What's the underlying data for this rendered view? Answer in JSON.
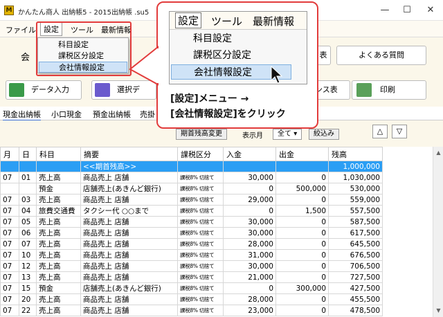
{
  "window": {
    "title": "かんたん商人 出納帳5 - 2015出納帳 .su5",
    "icon_letter": "M",
    "minimize": "—",
    "maximize": "☐",
    "close": "✕"
  },
  "menubar": {
    "file": "ファイル",
    "settings": "設定",
    "tools": "ツール",
    "latest_info": "最新情報"
  },
  "settings_menu": {
    "items": [
      "科目設定",
      "課税区分設定",
      "会社情報設定"
    ],
    "highlighted_index": 2
  },
  "callout": {
    "menu": {
      "settings": "設定",
      "tools": "ツール",
      "latest_info": "最新情報"
    },
    "items": [
      "科目設定",
      "課税区分設定",
      "会社情報設定"
    ],
    "instruction_line1": "[設定]メニュー →",
    "instruction_line2": "[会社情報設定]をクリック"
  },
  "toolbar": {
    "company_label": "会",
    "data_entry": "データ入力",
    "select_data": "選択デ",
    "balance_table": "ンス表",
    "print": "印刷",
    "faq": "よくある質問",
    "right_tab_partial": "表"
  },
  "tabs": [
    "現金出納帳",
    "小口現金",
    "預金出納帳",
    "売掛"
  ],
  "filter": {
    "opening_balance_change": "期首残高変更",
    "display_month": "表示月",
    "month_value": "全て",
    "narrow": "絞込み",
    "up": "△",
    "down": "▽"
  },
  "table": {
    "headers": [
      "月",
      "日",
      "科目",
      "摘要",
      "課税区分",
      "入金",
      "出金",
      "残高"
    ],
    "opening_row": {
      "label": "<<期首残高>>",
      "balance": "1,000,000"
    },
    "rows": [
      [
        "07",
        "01",
        "売上高",
        "商品売上 店舗",
        "課税8% 切捨て",
        "30,000",
        "0",
        "1,030,000"
      ],
      [
        "",
        "",
        "預金",
        "店舗売上(あきんど銀行)",
        "課税8% 切捨て",
        "0",
        "500,000",
        "530,000"
      ],
      [
        "07",
        "03",
        "売上高",
        "商品売上 店舗",
        "課税8% 切捨て",
        "29,000",
        "0",
        "559,000"
      ],
      [
        "07",
        "04",
        "旅費交通費",
        "タクシー代 ○○まで",
        "課税8% 切捨て",
        "0",
        "1,500",
        "557,500"
      ],
      [
        "07",
        "05",
        "売上高",
        "商品売上 店舗",
        "課税8% 切捨て",
        "30,000",
        "0",
        "587,500"
      ],
      [
        "07",
        "06",
        "売上高",
        "商品売上 店舗",
        "課税8% 切捨て",
        "30,000",
        "0",
        "617,500"
      ],
      [
        "07",
        "07",
        "売上高",
        "商品売上 店舗",
        "課税8% 切捨て",
        "28,000",
        "0",
        "645,500"
      ],
      [
        "07",
        "10",
        "売上高",
        "商品売上 店舗",
        "課税8% 切捨て",
        "31,000",
        "0",
        "676,500"
      ],
      [
        "07",
        "12",
        "売上高",
        "商品売上 店舗",
        "課税8% 切捨て",
        "30,000",
        "0",
        "706,500"
      ],
      [
        "07",
        "13",
        "売上高",
        "商品売上 店舗",
        "課税8% 切捨て",
        "21,000",
        "0",
        "727,500"
      ],
      [
        "07",
        "15",
        "預金",
        "店舗売上(あきんど銀行)",
        "課税8% 切捨て",
        "0",
        "300,000",
        "427,500"
      ],
      [
        "07",
        "20",
        "売上高",
        "商品売上 店舗",
        "課税8% 切捨て",
        "28,000",
        "0",
        "455,500"
      ],
      [
        "07",
        "22",
        "売上高",
        "商品売上 店舗",
        "課税8% 切捨て",
        "23,000",
        "0",
        "478,500"
      ]
    ]
  },
  "colors": {
    "highlight_red": "#e23c3c",
    "opening_row_blue": "#2b9ef4",
    "menu_highlight": "#cfe3f7"
  }
}
